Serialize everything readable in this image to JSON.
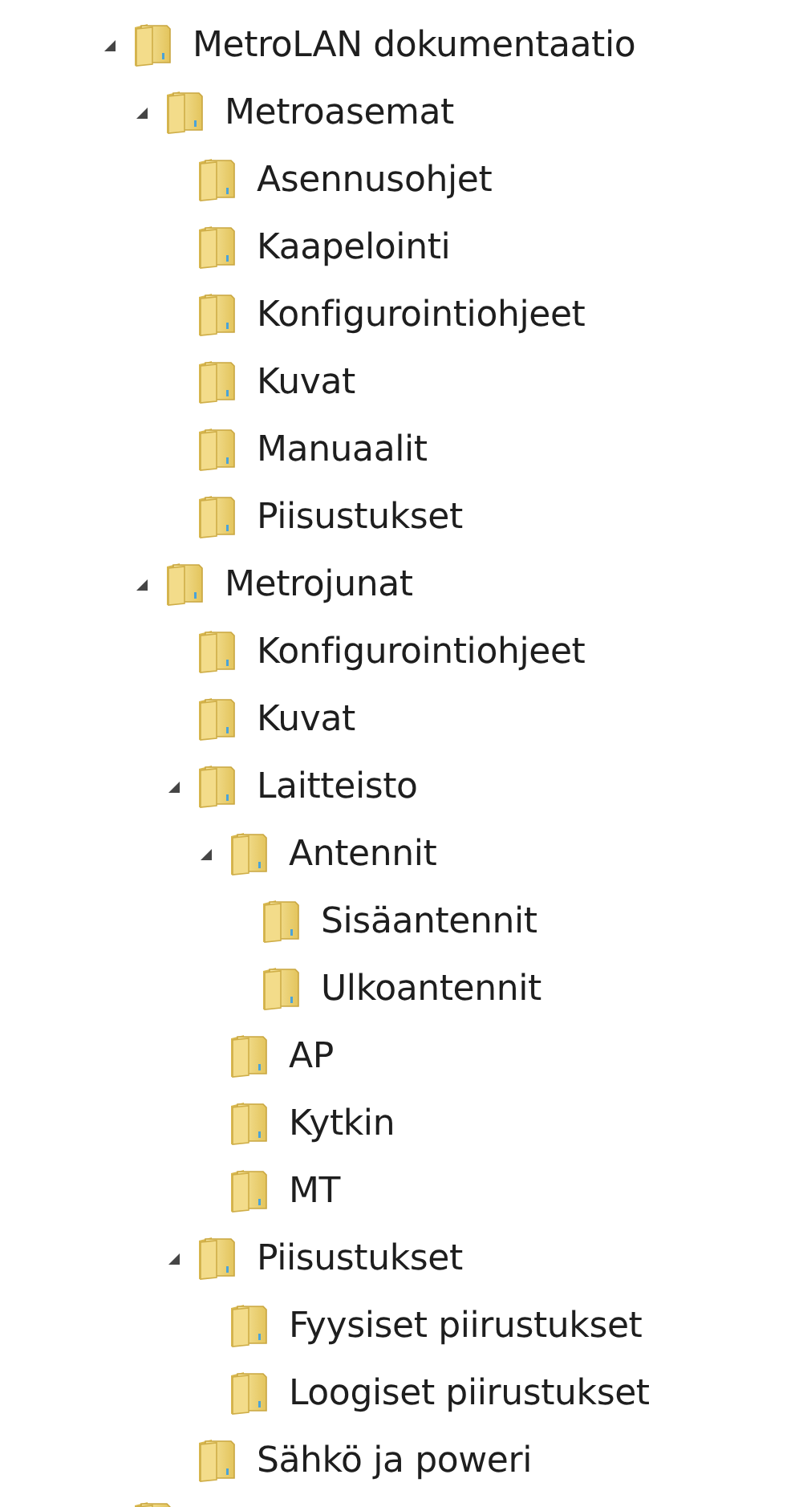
{
  "tree": [
    {
      "label": "MetroLAN dokumentaatio",
      "expanded": true,
      "children": [
        {
          "label": "Metroasemat",
          "expanded": true,
          "children": [
            {
              "label": "Asennusohjet"
            },
            {
              "label": "Kaapelointi"
            },
            {
              "label": "Konfigurointiohjeet"
            },
            {
              "label": "Kuvat"
            },
            {
              "label": "Manuaalit"
            },
            {
              "label": "Piisustukset"
            }
          ]
        },
        {
          "label": "Metrojunat",
          "expanded": true,
          "children": [
            {
              "label": "Konfigurointiohjeet"
            },
            {
              "label": "Kuvat"
            },
            {
              "label": "Laitteisto",
              "expanded": true,
              "children": [
                {
                  "label": "Antennit",
                  "expanded": true,
                  "children": [
                    {
                      "label": "Sisäantennit"
                    },
                    {
                      "label": "Ulkoantennit"
                    }
                  ]
                },
                {
                  "label": "AP"
                },
                {
                  "label": "Kytkin"
                },
                {
                  "label": "MT"
                }
              ]
            },
            {
              "label": "Piisustukset",
              "expanded": true,
              "children": [
                {
                  "label": "Fyysiset piirustukset"
                },
                {
                  "label": "Loogiset piirustukset"
                }
              ]
            },
            {
              "label": "Sähkö ja poweri"
            }
          ]
        }
      ]
    },
    {
      "kind": "cut-off"
    }
  ]
}
